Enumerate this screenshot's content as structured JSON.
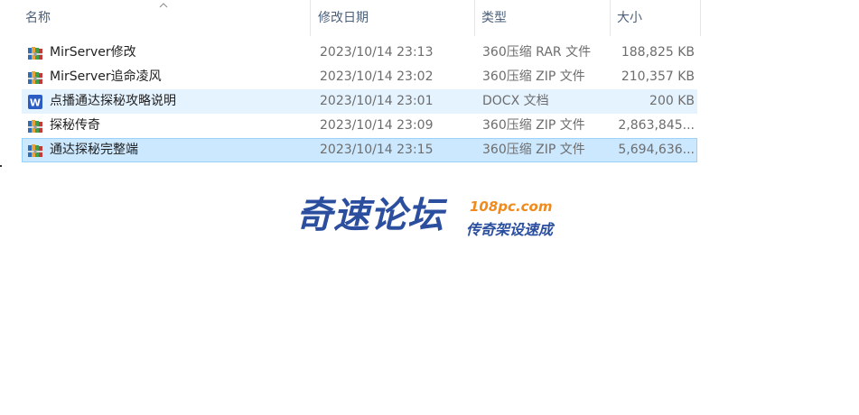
{
  "columns": {
    "name": "名称",
    "date": "修改日期",
    "type": "类型",
    "size": "大小"
  },
  "files": [
    {
      "name": "MirServer修改",
      "date": "2023/10/14 23:13",
      "type": "360压缩 RAR 文件",
      "size": "188,825 KB",
      "icon": "archive-icon"
    },
    {
      "name": "MirServer追命凌风",
      "date": "2023/10/14 23:02",
      "type": "360压缩 ZIP 文件",
      "size": "210,357 KB",
      "icon": "archive-icon"
    },
    {
      "name": "点播通达探秘攻略说明",
      "date": "2023/10/14 23:01",
      "type": "DOCX 文档",
      "size": "200 KB",
      "icon": "word-doc-icon"
    },
    {
      "name": "探秘传奇",
      "date": "2023/10/14 23:09",
      "type": "360压缩 ZIP 文件",
      "size": "2,863,845...",
      "icon": "archive-icon"
    },
    {
      "name": "通达探秘完整端",
      "date": "2023/10/14 23:15",
      "type": "360压缩 ZIP 文件",
      "size": "5,694,636...",
      "icon": "archive-icon"
    }
  ],
  "watermark": {
    "main": "奇速论坛",
    "url": "108pc.com",
    "slogan": "传奇架设速成"
  },
  "colors": {
    "header_text": "#4c607a",
    "hover_row": "#e5f3ff",
    "selected_row": "#cce8ff",
    "selected_border": "#99d1ff",
    "watermark_blue": "#2b4f9e",
    "watermark_orange": "#f08a1c"
  }
}
